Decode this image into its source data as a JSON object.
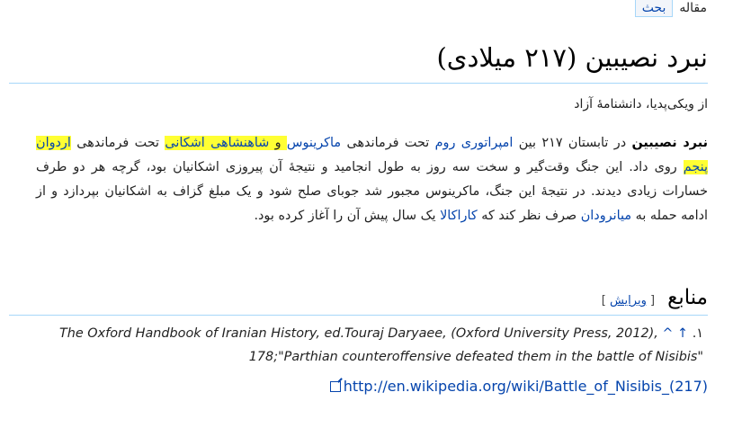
{
  "tabs": {
    "article": "مقاله",
    "talk": "بحث"
  },
  "title": "نبرد نصیبین (۲۱۷ میلادی)",
  "site_sub": "از ویکی‌پدیا، دانشنامهٔ آزاد",
  "paragraph": {
    "bold_start": "نبرد نصیبین",
    "t1": " در تابستان ۲۱۷ بین ",
    "link_roman_empire": "امپراتوری روم",
    "t2": " تحت فرماندهی ",
    "link_macrinus": "ماکرینوس",
    "t3": " و ",
    "link_parthian_empire": "شاهنشاهی اشکانی",
    "t4": " تحت فرماندهی ",
    "link_artabanus": "اردوان پنجم",
    "t5": " روی داد. این جنگ وقت‌گیر و سخت سه روز به طول انجامید و نتیجهٔ آن پیروزی اشکانیان بود، گرچه هر دو طرف خسارات زیادی دیدند. در نتیجهٔ این جنگ، ماکرینوس مجبور شد جوبای صلح شود و یک مبلغ گزاف به اشکانیان بپردازد و از ادامه حمله به ",
    "link_mesopotamia": "میانرودان",
    "t6": " صرف نظر کند که ",
    "link_caracalla": "کاراکالا",
    "t7": " یک سال پیش آن را آغاز کرده بود."
  },
  "references": {
    "heading": "منابع",
    "edit_open": "[",
    "edit_label": "ویرایش",
    "edit_close": "]",
    "items": [
      {
        "num": "۱.",
        "arrow": "↑",
        "caret": "^",
        "text": "The Oxford Handbook of Iranian History, ed.Touraj Daryaee, (Oxford University Press, 2012), 178;\"Parthian counteroffensive defeated them in the battle of Nisibis\""
      }
    ]
  },
  "external_link": "http://en.wikipedia.org/wiki/Battle_of_Nisibis_(217)"
}
